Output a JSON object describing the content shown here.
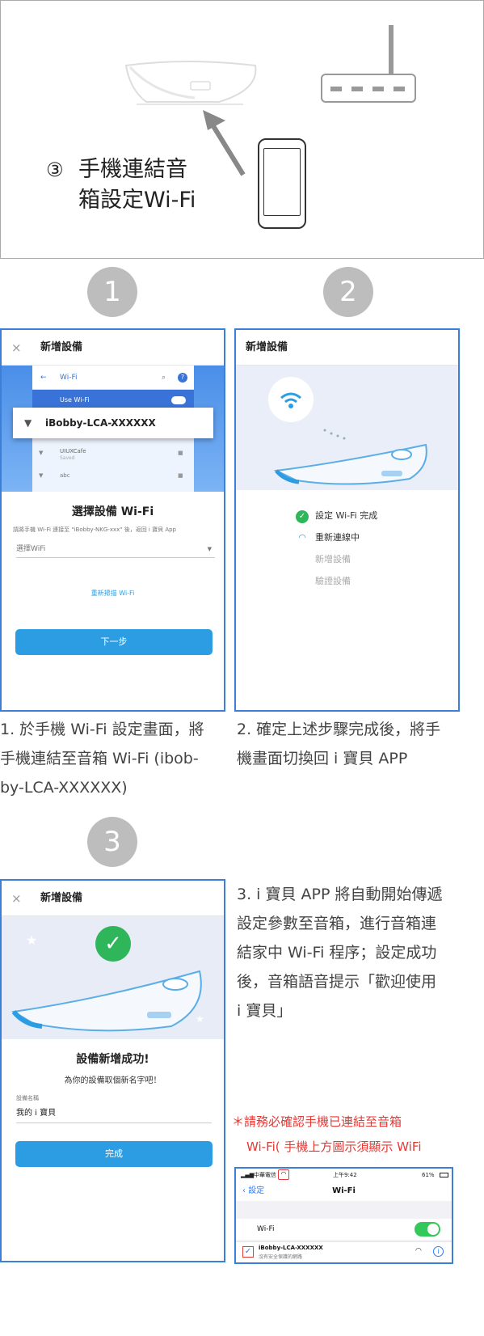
{
  "top": {
    "step_marker": "③",
    "step_line1": "手機連結音",
    "step_line2": "箱設定Wi-Fi"
  },
  "circles": [
    "1",
    "2",
    "3"
  ],
  "screen1": {
    "close": "×",
    "header": "新增設備",
    "wifi_label": "Wi-Fi",
    "use_wifi": "Use Wi-Fi",
    "network_selected": "iBobby-LCA-XXXXXX",
    "network2": "UIUXCafe",
    "network2_sub": "Saved",
    "network3": "abc",
    "title": "選擇設備 Wi-Fi",
    "instruction": "請將手機 Wi-Fi 連接至 \"iBobby-NKG-xxx\" 後，返回 i 寶貝 App",
    "select_placeholder": "選擇WiFi",
    "rescan": "重新掃描 Wi-Fi",
    "next_button": "下一步"
  },
  "screen2": {
    "header": "新增設備",
    "steps": [
      {
        "label": "設定 Wi-Fi 完成",
        "state": "done"
      },
      {
        "label": "重新連線中",
        "state": "active"
      },
      {
        "label": "新增設備",
        "state": "pending"
      },
      {
        "label": "驗證設備",
        "state": "pending"
      }
    ]
  },
  "screen3": {
    "close": "×",
    "header": "新增設備",
    "success_title": "設備新增成功!",
    "success_sub": "為你的設備取個新名字吧！",
    "name_label": "設備名稱",
    "name_value": "我的 i 寶貝",
    "done_button": "完成"
  },
  "captions": {
    "c1": "1. 於手機 Wi-Fi 設定畫面，將手機連結至音箱 Wi-Fi (ibobby-LCA-XXXXXX)",
    "c1_l1": "1. 於手機 Wi-Fi 設定畫面，將",
    "c1_l2": "手機連結至音箱 Wi-Fi (ibob-",
    "c1_l3": "by-LCA-XXXXXX)",
    "c2_l1": "2. 確定上述步驟完成後，將手",
    "c2_l2": "機畫面切換回 i 寶貝 APP",
    "c3_l1": "3. i 寶貝 APP 將自動開始傳遞",
    "c3_l2": "設定參數至音箱，進行音箱連",
    "c3_l3": "結家中 Wi-Fi 程序；設定成功",
    "c3_l4": "後，音箱語音提示「歡迎使用",
    "c3_l5": "i 寶貝」"
  },
  "warning": {
    "line1": "＊請務必確認手機已連結至音箱",
    "line2": "Wi-Fi( 手機上方圖示須顯示 WiFi"
  },
  "ios": {
    "carrier": "中華電信",
    "time": "上午9:42",
    "battery": "61%",
    "back": "設定",
    "title": "Wi-Fi",
    "wifi_row": "Wi-Fi",
    "network": "iBobby-LCA-XXXXXX",
    "network_sub": "沒有安全保護的網路"
  },
  "colors": {
    "accent": "#2d9de3",
    "frame": "#3b7fd9",
    "success": "#2fb55a",
    "warning": "#e53935",
    "circle": "#bdbdbd"
  }
}
